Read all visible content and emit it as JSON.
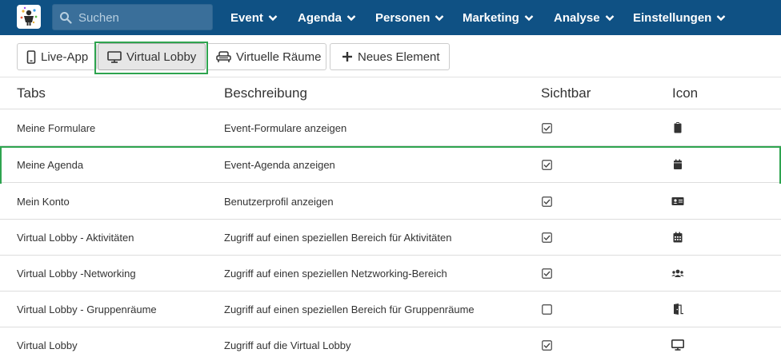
{
  "navbar": {
    "search_placeholder": "Suchen",
    "menu": [
      {
        "label": "Event"
      },
      {
        "label": "Agenda"
      },
      {
        "label": "Personen"
      },
      {
        "label": "Marketing"
      },
      {
        "label": "Analyse"
      },
      {
        "label": "Einstellungen"
      }
    ]
  },
  "toolbar": {
    "buttons": [
      {
        "label": "Live-App",
        "icon": "mobile-phone-icon"
      },
      {
        "label": "Virtual Lobby",
        "icon": "monitor-icon",
        "active": true
      },
      {
        "label": "Virtuelle Räume",
        "icon": "couch-icon"
      },
      {
        "label": "Neues Element",
        "icon": "plus-icon"
      }
    ]
  },
  "table": {
    "headers": [
      "Tabs",
      "Beschreibung",
      "Sichtbar",
      "Icon"
    ],
    "rows": [
      {
        "tab": "Meine Formulare",
        "description": "Event-Formulare anzeigen",
        "visible": true,
        "icon": "clipboard-icon"
      },
      {
        "tab": "Meine Agenda",
        "description": "Event-Agenda anzeigen",
        "visible": true,
        "icon": "calendar-icon"
      },
      {
        "tab": "Mein Konto",
        "description": "Benutzerprofil anzeigen",
        "visible": true,
        "icon": "id-card-icon"
      },
      {
        "tab": "Virtual Lobby - Aktivitäten",
        "description": "Zugriff auf einen speziellen Bereich für Aktivitäten",
        "visible": true,
        "icon": "calendar-grid-icon"
      },
      {
        "tab": "Virtual Lobby -Networking",
        "description": "Zugriff auf einen speziellen Netzworking-Bereich",
        "visible": true,
        "icon": "users-icon"
      },
      {
        "tab": "Virtual Lobby - Gruppenräume",
        "description": "Zugriff auf einen speziellen Bereich für Gruppenräume",
        "visible": false,
        "icon": "door-open-icon"
      },
      {
        "tab": "Virtual Lobby",
        "description": "Zugriff auf die Virtual Lobby",
        "visible": true,
        "icon": "monitor-icon"
      }
    ]
  },
  "colors": {
    "navbar_bg": "#0f5184",
    "highlight": "#2ea44f",
    "text": "#333333",
    "border": "#dddddd"
  }
}
